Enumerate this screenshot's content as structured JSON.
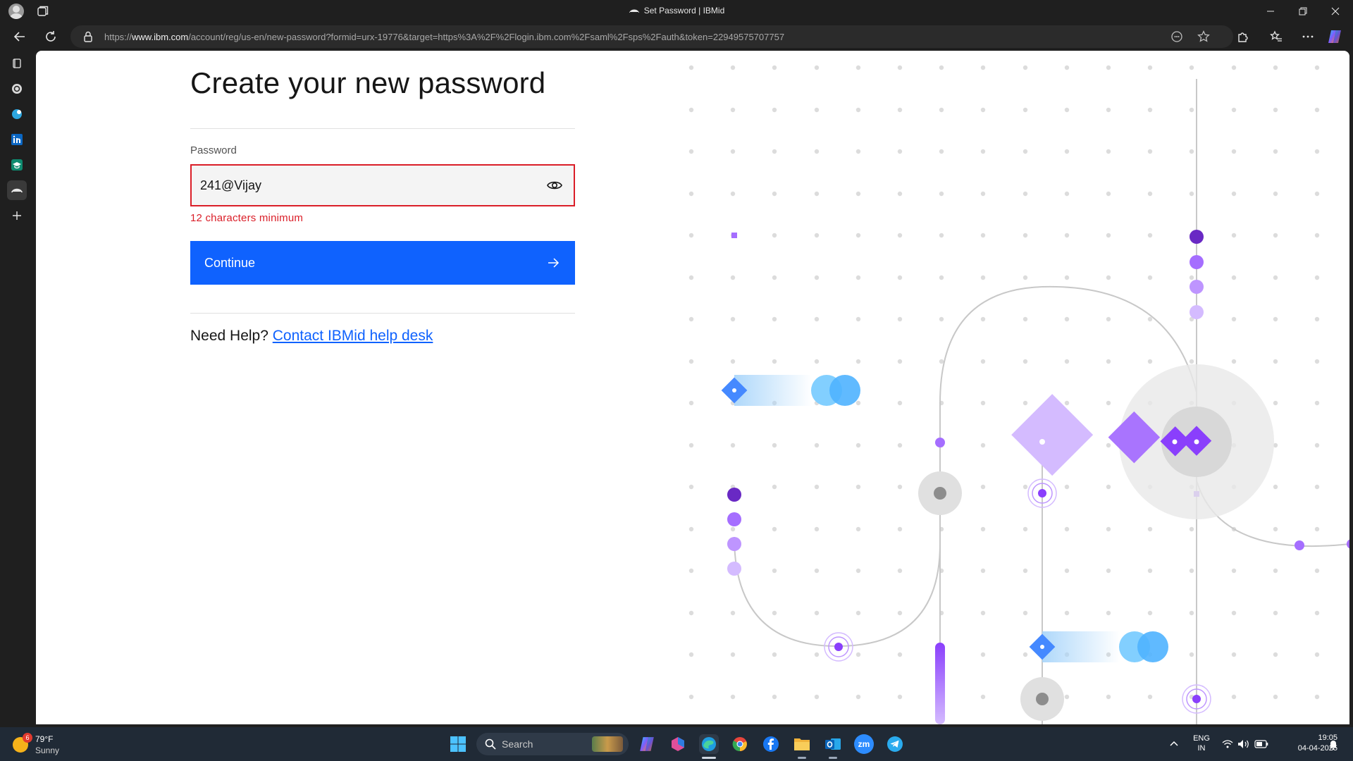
{
  "browser": {
    "tab_title": "Set Password | IBMid",
    "url_prefix": "https://",
    "url_domain": "www.ibm.com",
    "url_rest": "/account/reg/us-en/new-password?formid=urx-19776&target=https%3A%2F%2Flogin.ibm.com%2Fsaml%2Fsps%2Fauth&token=22949575707757"
  },
  "page": {
    "title": "Create your new password",
    "password_label": "Password",
    "password_value": "241@Vijay",
    "error_text": "12 characters minimum",
    "continue_label": "Continue",
    "help_prefix": "Need Help?",
    "help_link": "Contact IBMid help desk"
  },
  "colors": {
    "primary_button": "#0f62fe",
    "error": "#da1e28",
    "link": "#0f62fe"
  },
  "sidebar_icons": [
    "collections-icon",
    "chatgpt-icon",
    "copilot-icon",
    "linkedin-icon",
    "graduation-icon",
    "ibm-tab-icon",
    "add-icon"
  ],
  "taskbar": {
    "weather_badge": "6",
    "weather_temp": "79°F",
    "weather_condition": "Sunny",
    "search_label": "Search",
    "apps": [
      "windows-start-icon",
      "copilot-icon",
      "m365-icon",
      "edge-icon",
      "chrome-icon",
      "facebook-icon",
      "file-explorer-icon",
      "outlook-icon",
      "zoom-icon",
      "telegram-icon"
    ],
    "zoom_label": "zm",
    "m365_label": "M365",
    "language_line1": "ENG",
    "language_line2": "IN",
    "time": "19:05",
    "date": "04-04-2025"
  }
}
